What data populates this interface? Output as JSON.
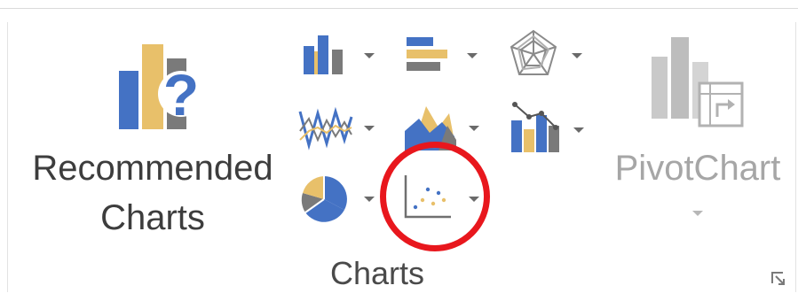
{
  "ribbon": {
    "recommended": {
      "line1": "Recommended",
      "line2": "Charts",
      "icon": "recommended-charts-icon"
    },
    "chart_buttons": [
      {
        "name": "column-bar-chart",
        "icon": "column-chart-icon"
      },
      {
        "name": "hierarchy-chart",
        "icon": "bar-chart-icon"
      },
      {
        "name": "radar-chart",
        "icon": "radar-chart-icon"
      },
      {
        "name": "line-chart",
        "icon": "line-chart-icon"
      },
      {
        "name": "area-chart",
        "icon": "area-chart-icon"
      },
      {
        "name": "combo-chart",
        "icon": "combo-chart-icon"
      },
      {
        "name": "pie-chart",
        "icon": "pie-chart-icon"
      },
      {
        "name": "scatter-chart",
        "icon": "scatter-chart-icon",
        "highlighted": true
      }
    ],
    "pivot": {
      "label": "PivotChart",
      "icon": "pivotchart-icon",
      "enabled": false
    },
    "group_label": "Charts"
  },
  "colors": {
    "blue": "#4472c4",
    "gold": "#e8c06a",
    "grey": "#7a7a7a",
    "highlight": "#e8171d"
  }
}
